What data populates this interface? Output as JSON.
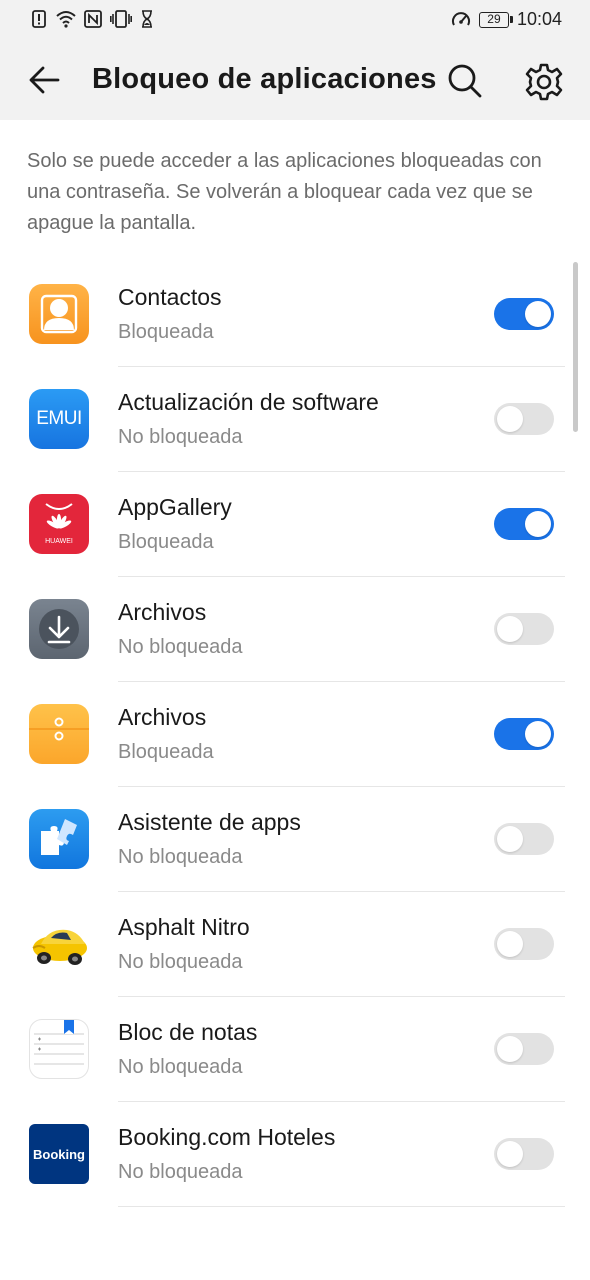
{
  "status_bar": {
    "time": "10:04",
    "battery": "29",
    "icons": [
      "alert-icon",
      "wifi-icon",
      "nfc-icon",
      "vibrate-icon",
      "hourglass-icon",
      "data-saver-icon",
      "battery-icon"
    ]
  },
  "header": {
    "title": "Bloqueo de aplicaciones",
    "back_icon": "back-arrow-icon",
    "search_icon": "search-icon",
    "settings_icon": "gear-icon"
  },
  "description": "Solo se puede acceder a las aplicaciones bloqueadas con una contraseña. Se volverán a bloquear cada vez que se apague la pantalla.",
  "apps": [
    {
      "name": "Contactos",
      "status": "Bloqueada",
      "locked": true,
      "icon": "contacts-icon"
    },
    {
      "name": "Actualización de software",
      "status": "No bloqueada",
      "locked": false,
      "icon": "emui-update-icon",
      "icon_text": "EMUI"
    },
    {
      "name": "AppGallery",
      "status": "Bloqueada",
      "locked": true,
      "icon": "appgallery-icon",
      "icon_text": "HUAWEI"
    },
    {
      "name": "Archivos",
      "status": "No bloqueada",
      "locked": false,
      "icon": "download-files-icon"
    },
    {
      "name": "Archivos",
      "status": "Bloqueada",
      "locked": true,
      "icon": "files-folder-icon"
    },
    {
      "name": "Asistente de apps",
      "status": "No bloqueada",
      "locked": false,
      "icon": "puzzle-icon"
    },
    {
      "name": "Asphalt Nitro",
      "status": "No bloqueada",
      "locked": false,
      "icon": "race-car-icon"
    },
    {
      "name": "Bloc de notas",
      "status": "No bloqueada",
      "locked": false,
      "icon": "notepad-icon"
    },
    {
      "name": "Booking.com Hoteles",
      "status": "No bloqueada",
      "locked": false,
      "icon": "booking-icon",
      "icon_text": "Booking"
    }
  ],
  "colors": {
    "accent": "#1a73e8",
    "toggle_off": "#e2e2e2",
    "header_bg": "#f2f2f2"
  }
}
